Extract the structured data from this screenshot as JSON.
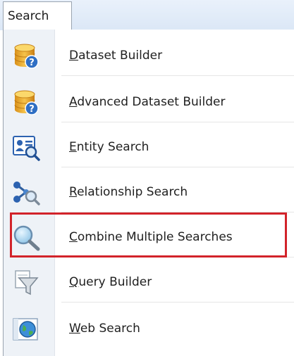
{
  "menu": {
    "tab_label": "Search"
  },
  "items": [
    {
      "first": "D",
      "rest": "ataset Builder",
      "icon": "database-help-icon"
    },
    {
      "first": "A",
      "rest": "dvanced Dataset Builder",
      "icon": "database-help-icon"
    },
    {
      "first": "E",
      "rest": "ntity Search",
      "icon": "entity-card-search-icon"
    },
    {
      "first": "R",
      "rest": "elationship Search",
      "icon": "relationship-nodes-search-icon"
    },
    {
      "first": "C",
      "rest": "ombine Multiple Searches",
      "icon": "magnifier-icon"
    },
    {
      "first": "Q",
      "rest": "uery Builder",
      "icon": "funnel-document-icon"
    },
    {
      "first": "W",
      "rest": "eb Search",
      "icon": "globe-window-icon"
    }
  ],
  "highlight": {
    "color": "#d2232a"
  }
}
